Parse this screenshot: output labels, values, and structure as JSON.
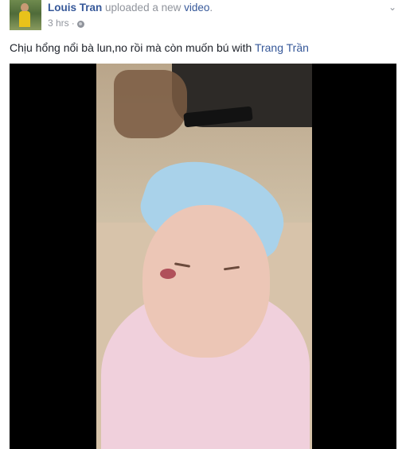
{
  "post": {
    "author": "Louis Tran",
    "action_text": " uploaded a new ",
    "video_link_text": "video",
    "period": ".",
    "timestamp": "3 hrs",
    "separator": "·",
    "privacy_icon": "globe-icon",
    "caption_text": "Chịu hổng nổi bà lun,no rồi mà còn muốn bú with ",
    "tagged_user": "Trang Trần",
    "options_icon": "chevron-down-icon"
  },
  "colors": {
    "link": "#365899",
    "meta": "#90949c",
    "text": "#1d2129",
    "video_background": "#000000"
  }
}
